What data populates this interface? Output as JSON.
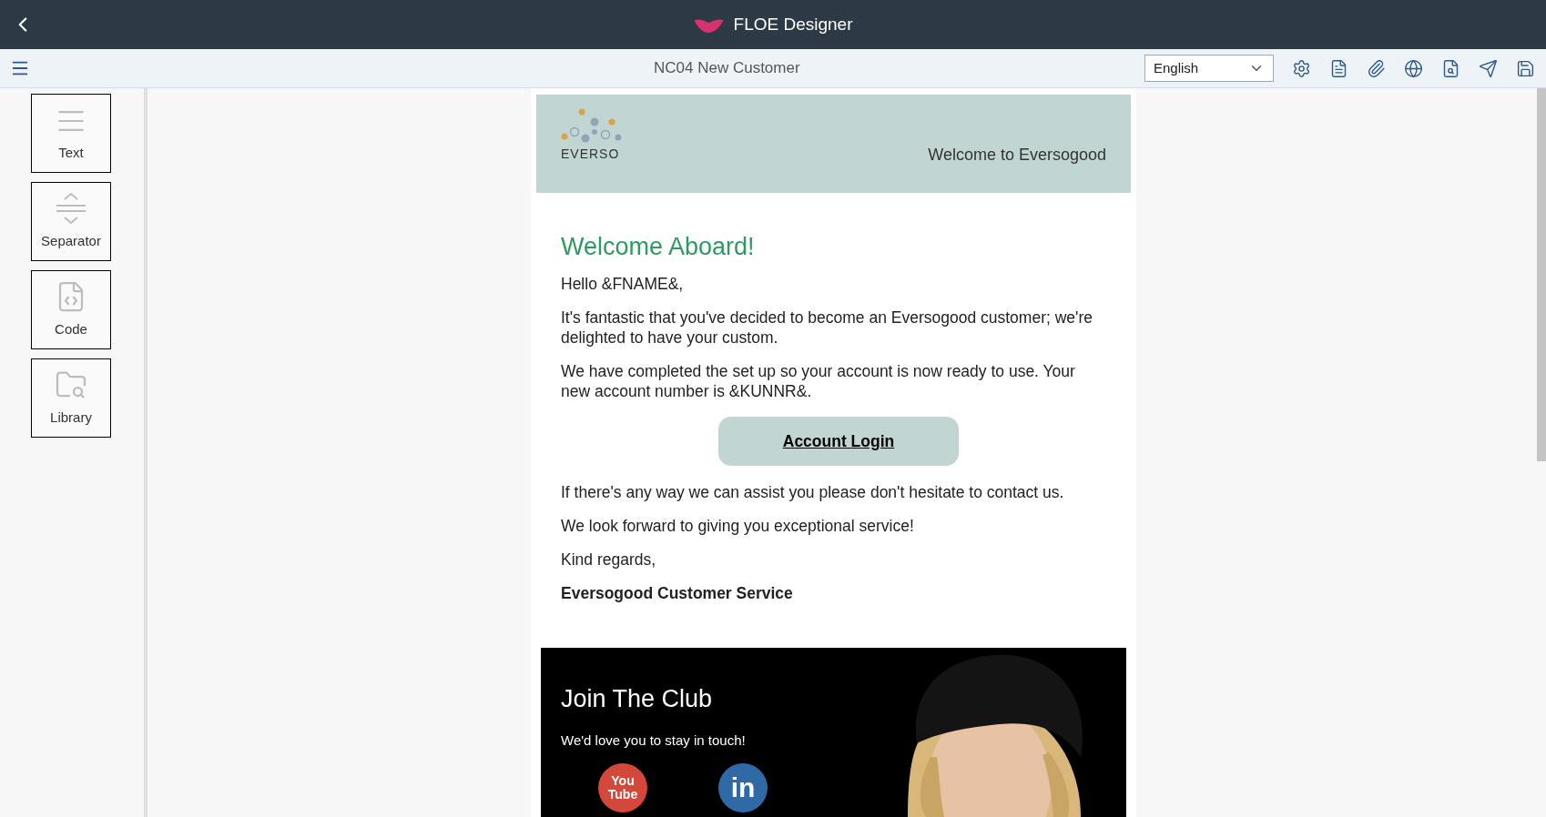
{
  "header": {
    "title": "FLOE Designer"
  },
  "toolbar": {
    "document_title": "NC04 New Customer",
    "language": "English",
    "actions": [
      {
        "kind": "settings"
      },
      {
        "kind": "pdf"
      },
      {
        "kind": "attach"
      },
      {
        "kind": "globe"
      },
      {
        "kind": "preview"
      },
      {
        "kind": "send"
      },
      {
        "kind": "save"
      }
    ]
  },
  "palette": [
    {
      "label": "Text",
      "kind": "text"
    },
    {
      "label": "Separator",
      "kind": "separator"
    },
    {
      "label": "Code",
      "kind": "code"
    },
    {
      "label": "Library",
      "kind": "library"
    }
  ],
  "email": {
    "logo_text": "EVERSO",
    "banner_text": "Welcome to Eversogood",
    "heading": "Welcome Aboard!",
    "paragraphs": [
      "Hello &FNAME&,",
      "It's fantastic that you've decided to become an Eversogood customer; we're delighted to have your custom.",
      "We have completed the set up so your account is now ready to use. Your new account number is &KUNNR&."
    ],
    "button": "Account Login",
    "paragraphs_after": [
      "If there's any way we can assist you please don't hesitate to contact us.",
      "We look forward to giving you exceptional service!",
      "Kind regards,"
    ],
    "signature": "Eversogood Customer Service",
    "club": {
      "title": "Join The Club",
      "subtitle": "We'd love you to stay in touch!",
      "social": [
        {
          "kind": "youtube",
          "label_lines": [
            "You",
            "Tube"
          ]
        },
        {
          "kind": "linkedin",
          "label_lines": [
            "in"
          ]
        }
      ]
    }
  }
}
